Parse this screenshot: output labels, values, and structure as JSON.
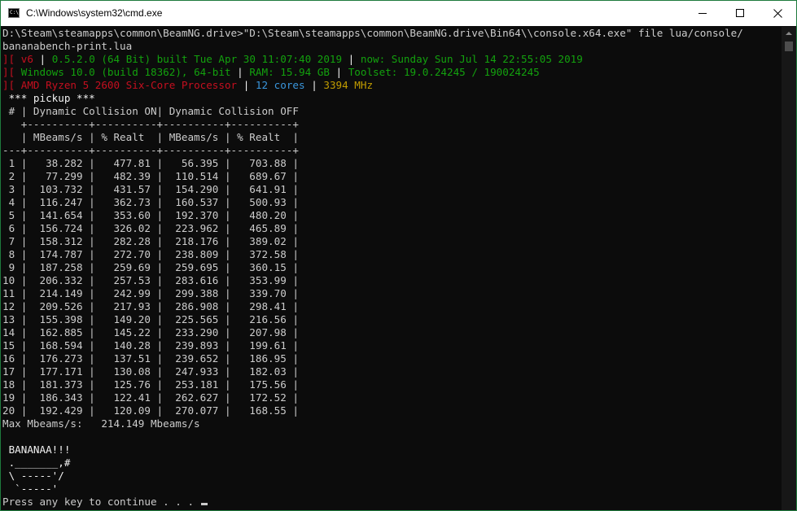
{
  "window": {
    "title": "C:\\Windows\\system32\\cmd.exe",
    "accent_color": "#1e7a3c"
  },
  "icons": {
    "app": "cmd-icon",
    "minimize": "minimize-icon",
    "maximize": "maximize-icon",
    "close": "close-icon"
  },
  "console": {
    "command_1": "D:\\Steam\\steamapps\\common\\BeamNG.drive>\"D:\\Steam\\steamapps\\common\\BeamNG.drive\\Bin64\\\\console.x64.exe\" file lua/console/",
    "command_2": "bananabench-print.lua",
    "info": {
      "bracket": "][",
      "sep": "|",
      "version": "v6",
      "build": "0.5.2.0 (64 Bit) built Tue Apr 30 11:07:40 2019",
      "now": "now: Sunday Sun Jul 14 22:55:05 2019",
      "os": "Windows 10.0 (build 18362), 64-bit",
      "ram": "RAM: 15.94 GB",
      "toolset": "Toolset: 19.0.24245 / 190024245",
      "cpu": "AMD Ryzen 5 2600 Six-Core Processor",
      "cores": "12 cores",
      "mhz": "3394 MHz"
    },
    "section_title": "*** pickup ***",
    "table": {
      "header_row": " # | Dynamic Collision ON| Dynamic Collision OFF",
      "border_1": "   +----------+----------+----------+----------+",
      "subheader_row": "   | MBeams/s | % Realt  | MBeams/s | % Realt  |",
      "border_2": "---+----------+----------+----------+----------+",
      "rows": [
        " 1 |   38.282 |   477.81 |   56.395 |   703.88 |",
        " 2 |   77.299 |   482.39 |  110.514 |   689.67 |",
        " 3 |  103.732 |   431.57 |  154.290 |   641.91 |",
        " 4 |  116.247 |   362.73 |  160.537 |   500.93 |",
        " 5 |  141.654 |   353.60 |  192.370 |   480.20 |",
        " 6 |  156.724 |   326.02 |  223.962 |   465.89 |",
        " 7 |  158.312 |   282.28 |  218.176 |   389.02 |",
        " 8 |  174.787 |   272.70 |  238.809 |   372.58 |",
        " 9 |  187.258 |   259.69 |  259.695 |   360.15 |",
        "10 |  206.332 |   257.53 |  283.616 |   353.99 |",
        "11 |  214.149 |   242.99 |  299.388 |   339.70 |",
        "12 |  209.526 |   217.93 |  286.908 |   298.41 |",
        "13 |  155.398 |   149.20 |  225.565 |   216.56 |",
        "14 |  162.885 |   145.22 |  233.290 |   207.98 |",
        "15 |  168.594 |   140.28 |  239.893 |   199.61 |",
        "16 |  176.273 |   137.51 |  239.652 |   186.95 |",
        "17 |  177.171 |   130.08 |  247.933 |   182.03 |",
        "18 |  181.373 |   125.76 |  253.181 |   175.56 |",
        "19 |  186.343 |   122.41 |  262.627 |   172.52 |",
        "20 |  192.429 |   120.09 |  270.077 |   168.55 |"
      ]
    },
    "max_line": "Max Mbeams/s:   214.149 Mbeams/s",
    "blank": "",
    "banana": [
      " BANANAA!!!",
      " ._______,#",
      " \\ -----'/",
      "  `-----'"
    ],
    "prompt": "Press any key to continue . . . "
  },
  "colors": {
    "background": "#0c0c0c",
    "text": "#cccccc",
    "red": "#c50f1f",
    "green": "#13a10e",
    "yellow": "#c19c00",
    "cyan": "#3a96dd"
  }
}
